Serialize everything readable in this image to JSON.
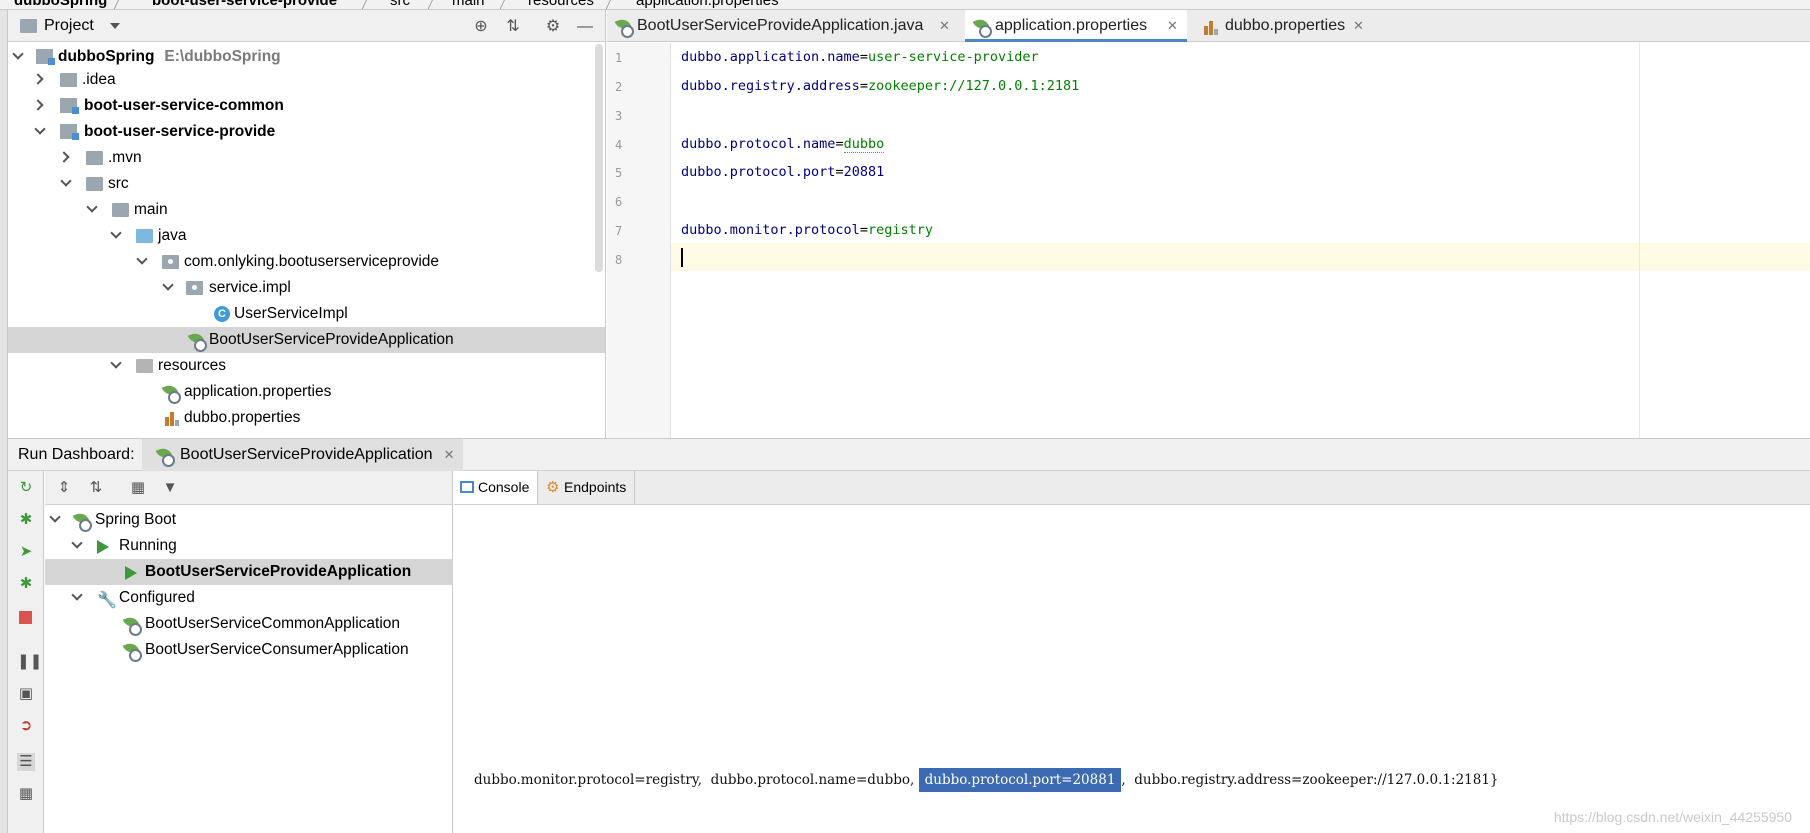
{
  "breadcrumbs": [
    "dubboSpring",
    "boot-user-service-provide",
    "src",
    "main",
    "resources",
    "application.properties"
  ],
  "project_panel": {
    "title": "Project",
    "tree": [
      {
        "label": "dubboSpring",
        "path": "E:\\dubboSpring",
        "bold": true,
        "expanded": true,
        "icon": "module-icon"
      },
      {
        "label": ".idea",
        "expanded": false,
        "icon": "folder-icon"
      },
      {
        "label": "boot-user-service-common",
        "bold": true,
        "expanded": false,
        "icon": "module-icon"
      },
      {
        "label": "boot-user-service-provide",
        "bold": true,
        "expanded": true,
        "icon": "module-icon"
      },
      {
        "label": ".mvn",
        "expanded": false,
        "icon": "folder-icon"
      },
      {
        "label": "src",
        "expanded": true,
        "icon": "folder-icon"
      },
      {
        "label": "main",
        "expanded": true,
        "icon": "folder-icon"
      },
      {
        "label": "java",
        "expanded": true,
        "icon": "source-folder-icon"
      },
      {
        "label": "com.onlyking.bootuserserviceprovide",
        "expanded": true,
        "icon": "package-icon"
      },
      {
        "label": "service.impl",
        "expanded": true,
        "icon": "package-icon"
      },
      {
        "label": "UserServiceImpl",
        "icon": "class-icon"
      },
      {
        "label": "BootUserServiceProvideApplication",
        "icon": "spring-boot-class-icon",
        "selected": true
      },
      {
        "label": "resources",
        "expanded": true,
        "icon": "resources-folder-icon"
      },
      {
        "label": "application.properties",
        "icon": "spring-properties-icon"
      },
      {
        "label": "dubbo.properties",
        "icon": "properties-icon"
      }
    ]
  },
  "editor": {
    "tabs": [
      {
        "label": "BootUserServiceProvideApplication.java",
        "active": false
      },
      {
        "label": "application.properties",
        "active": true
      },
      {
        "label": "dubbo.properties",
        "active": false
      }
    ],
    "lines": [
      {
        "num": "1",
        "key": "dubbo.application.name",
        "eq": "=",
        "value": "user-service-provider"
      },
      {
        "num": "2",
        "key": "dubbo.registry.address",
        "eq": "=",
        "value": "zookeeper://127.0.0.1:2181"
      },
      {
        "num": "3",
        "key": "",
        "eq": "",
        "value": ""
      },
      {
        "num": "4",
        "key": "dubbo.protocol.name",
        "eq": "=",
        "value": "dubbo"
      },
      {
        "num": "5",
        "key": "dubbo.protocol.port",
        "eq": "=",
        "value": "20881"
      },
      {
        "num": "6",
        "key": "",
        "eq": "",
        "value": ""
      },
      {
        "num": "7",
        "key": "dubbo.monitor.protocol",
        "eq": "=",
        "value": "registry"
      },
      {
        "num": "8",
        "key": "",
        "eq": "",
        "value": ""
      }
    ],
    "current_line": 8
  },
  "run_dashboard": {
    "label": "Run Dashboard:",
    "tab": "BootUserServiceProvideApplication",
    "tree": {
      "root": "Spring Boot",
      "running_group": "Running",
      "running_app": "BootUserServiceProvideApplication",
      "configured_group": "Configured",
      "configured_apps": [
        "BootUserServiceCommonApplication",
        "BootUserServiceConsumerApplication"
      ]
    },
    "console_tabs": [
      "Console",
      "Endpoints"
    ],
    "console_output": {
      "before": "dubbo.monitor.protocol=registry,  dubbo.protocol.name=dubbo,",
      "selected": "dubbo.protocol.port=20881",
      "after": ",  dubbo.registry.address=zookeeper://127.0.0.1:2181}"
    }
  },
  "watermark": "https://blog.csdn.net/weixin_44255950",
  "colors": {
    "selection": "#3d6bb3",
    "key": "#000080",
    "value": "#007f00",
    "active_tab_underline": "#4a86c8"
  }
}
